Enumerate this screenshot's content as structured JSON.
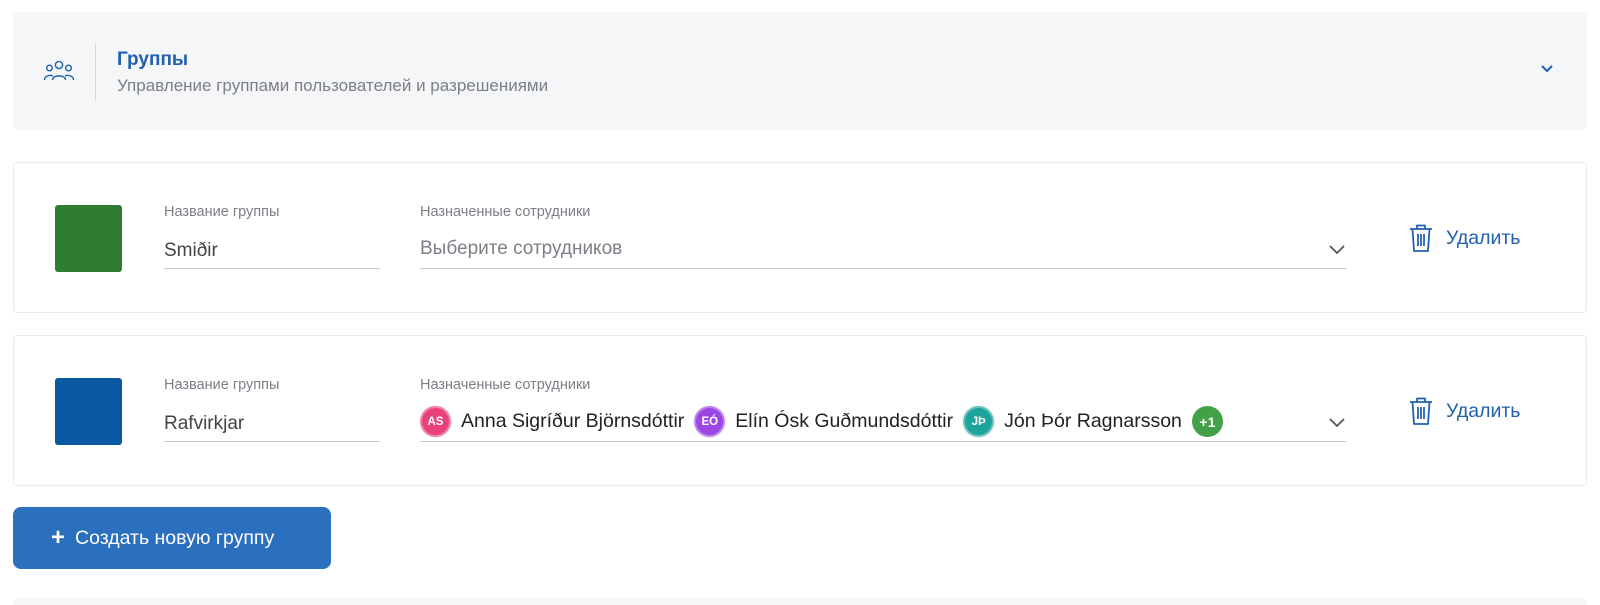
{
  "header": {
    "title": "Группы",
    "subtitle": "Управление группами пользователей и разрешениями",
    "icon": "users-group-icon",
    "accent_color": "#2160ad"
  },
  "groups": [
    {
      "color": "#2e7d32",
      "name_label": "Название группы",
      "name_value": "Smiðir",
      "employees_label": "Назначенные сотрудники",
      "employees_placeholder": "Выберите сотрудников",
      "employees": [],
      "delete_label": "Удалить"
    },
    {
      "color": "#0b58a3",
      "name_label": "Название группы",
      "name_value": "Rafvirkjar",
      "employees_label": "Назначенные сотрудники",
      "employees_placeholder": "",
      "employees": [
        {
          "initials": "AS",
          "name": "Anna Sigríður Björnsdóttir",
          "color": "#e8407a"
        },
        {
          "initials": "EÓ",
          "name": "Elín Ósk Guðmundsdóttir",
          "color": "#9b45e4"
        },
        {
          "initials": "JÞ",
          "name": "Jón Þór Ragnarsson",
          "color": "#1ca39a"
        }
      ],
      "more_count": "+1",
      "more_color": "#43a047",
      "delete_label": "Удалить"
    }
  ],
  "create_button": {
    "plus": "+",
    "label": "Создать новую группу",
    "color": "#2b6fbf"
  }
}
